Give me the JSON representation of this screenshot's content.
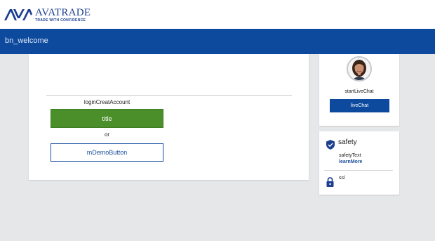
{
  "header": {
    "logo_name": "AVATRADE",
    "logo_tagline": "TRADE WITH CONFIDENCE",
    "brand_color": "#1c3f8f"
  },
  "banner": {
    "title": "bn_welcome",
    "color": "#0d4a9e"
  },
  "login": {
    "create_account_label": "loginCreatAccount",
    "title_button": "title",
    "or_label": "or",
    "demo_button": "mDemoButton",
    "primary_color": "#4a8f2a"
  },
  "chat": {
    "start_label": "startLiveChat",
    "button": "liveChat"
  },
  "safety": {
    "title": "safety",
    "text": "safetyText",
    "learn_more": "learnMore",
    "ssl": "ssl",
    "icons": [
      "shield-check-icon",
      "lock-icon"
    ]
  }
}
